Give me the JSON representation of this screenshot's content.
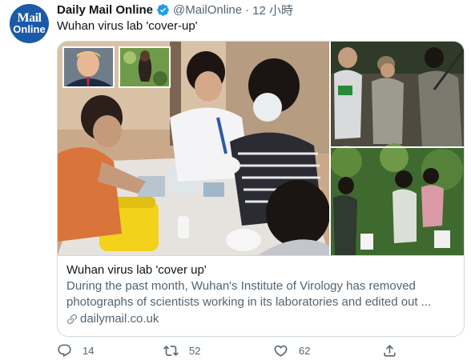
{
  "author": {
    "avatar_line1": "Mail",
    "avatar_line2": "Online",
    "display_name": "Daily Mail Online",
    "handle": "@MailOnline",
    "separator": "·",
    "time": "12 小時"
  },
  "tweet": {
    "text": "Wuhan virus lab 'cover-up'"
  },
  "card": {
    "title": "Wuhan virus lab 'cover up'",
    "description_line1": "During the past month, Wuhan's Institute of Virology has removed",
    "description_line2": "photographs of scientists working in its laboratories and edited out ...",
    "domain": "dailymail.co.uk"
  },
  "actions": {
    "reply_count": "14",
    "retweet_count": "52",
    "like_count": "62"
  },
  "colors": {
    "verified": "#1d9bf0",
    "muted": "#536471",
    "brand_avatar": "#1a5aa8"
  }
}
